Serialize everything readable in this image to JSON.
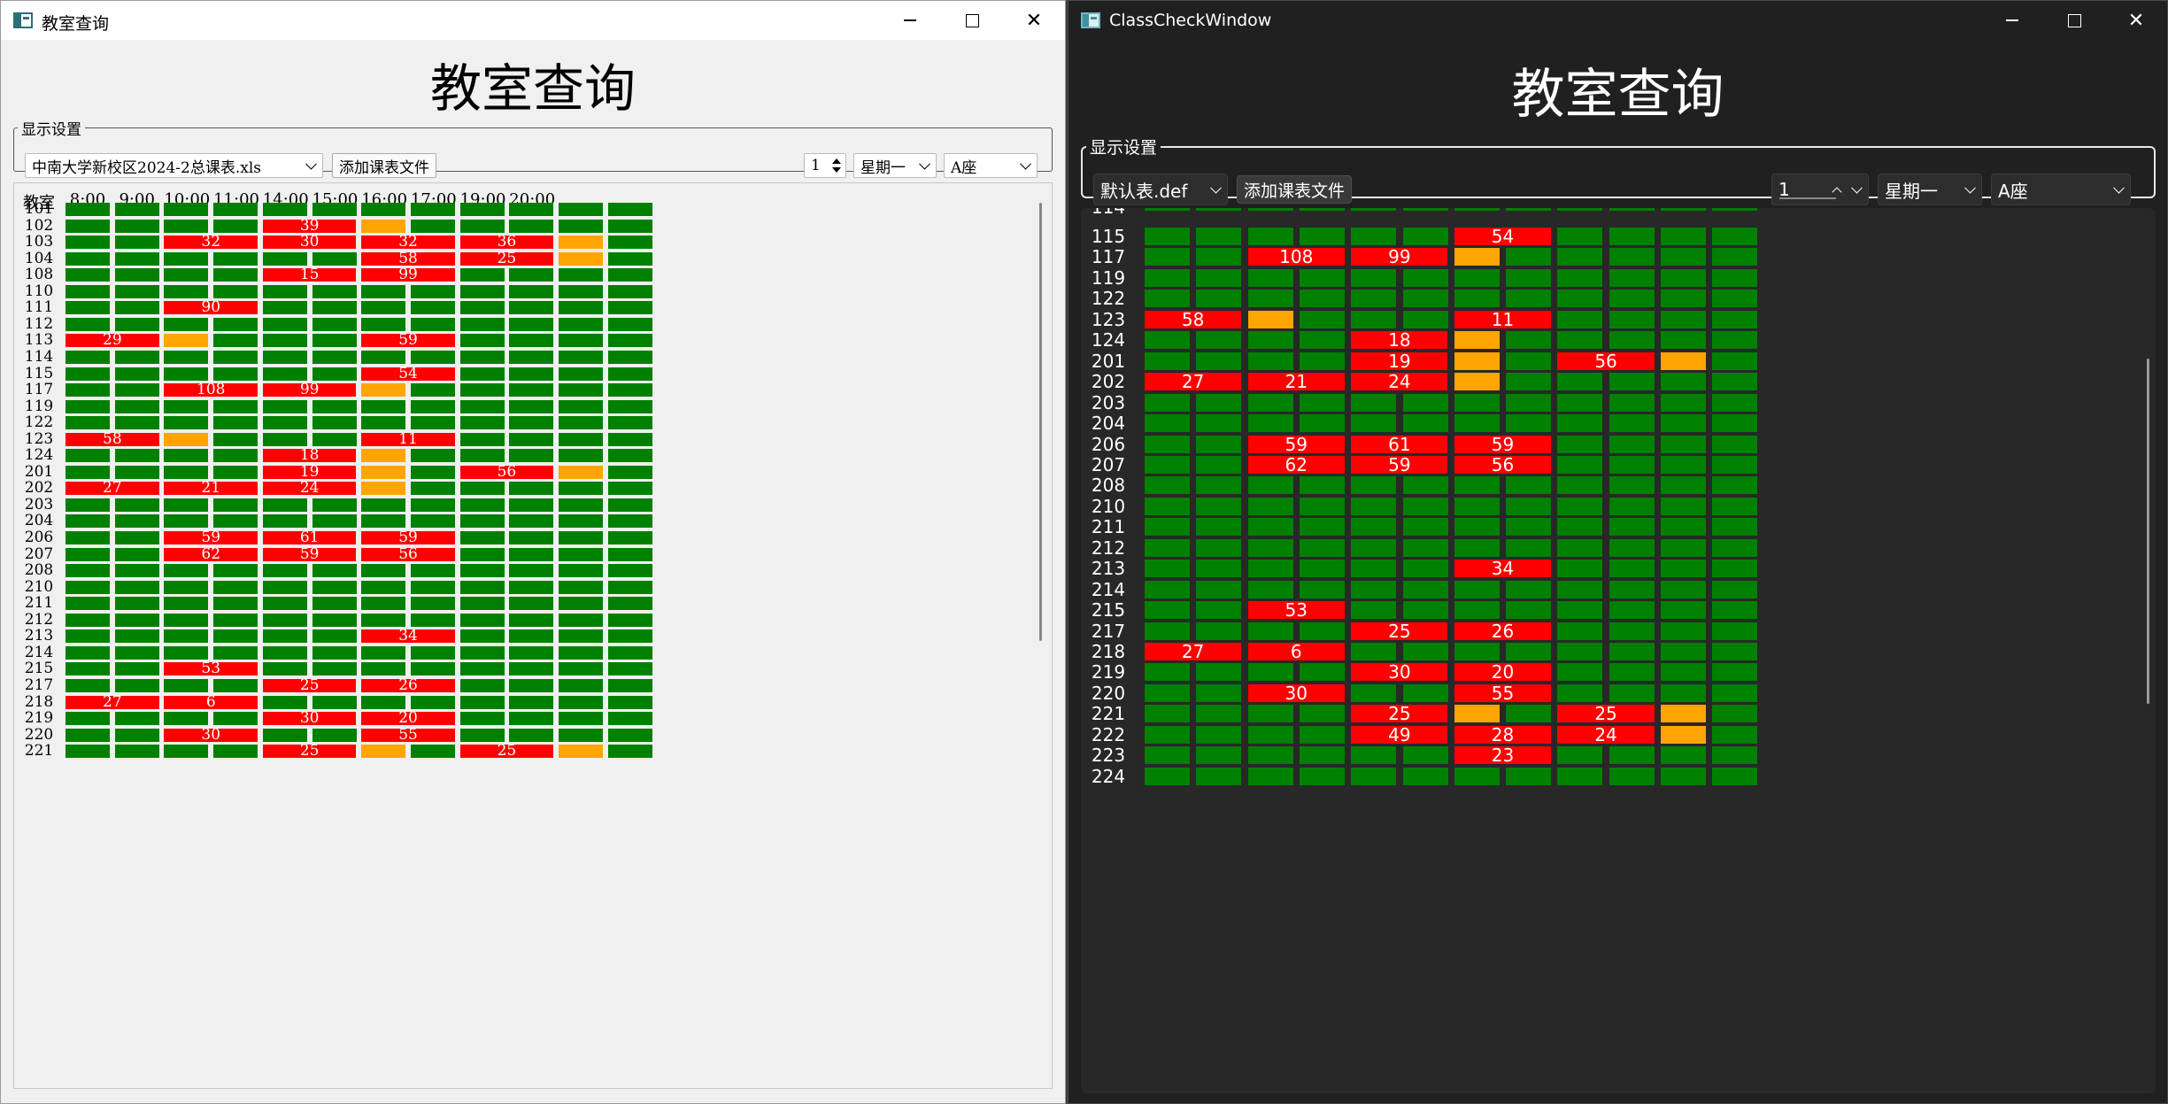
{
  "left": {
    "window_title": "教室查询",
    "heading": "教室查询",
    "group_title": "显示设置",
    "file_select": "中南大学新校区2024-2总课表.xls",
    "add_button": "添加课表文件",
    "week_spin": "1",
    "weekday_select": "星期一",
    "building_select": "A座",
    "header_room": "教室",
    "times": [
      "8:00",
      "9:00",
      "10:00",
      "11:00",
      "14:00",
      "15:00",
      "16:00",
      "17:00",
      "19:00",
      "20:00"
    ],
    "rows": [
      {
        "room": "101",
        "cells": [
          "g",
          "g",
          "g",
          "g",
          "g",
          "g",
          "g",
          "g",
          "g",
          "g",
          "g",
          "g"
        ]
      },
      {
        "room": "102",
        "cells": [
          "g",
          "g",
          "g",
          "g",
          "39",
          "",
          "o",
          "g",
          "g",
          "g",
          "g",
          "g"
        ]
      },
      {
        "room": "103",
        "cells": [
          "g",
          "g",
          "32",
          "",
          "30",
          "",
          "32",
          "",
          "36",
          "",
          "o",
          "g"
        ]
      },
      {
        "room": "104",
        "cells": [
          "g",
          "g",
          "g",
          "g",
          "g",
          "g",
          "58",
          "",
          "25",
          "",
          "o",
          "g"
        ]
      },
      {
        "room": "108",
        "cells": [
          "g",
          "g",
          "g",
          "g",
          "15",
          "",
          "99",
          "",
          "g",
          "g",
          "g",
          "g"
        ]
      },
      {
        "room": "110",
        "cells": [
          "g",
          "g",
          "g",
          "g",
          "g",
          "g",
          "g",
          "g",
          "g",
          "g",
          "g",
          "g"
        ]
      },
      {
        "room": "111",
        "cells": [
          "g",
          "g",
          "90",
          "",
          "g",
          "g",
          "g",
          "g",
          "g",
          "g",
          "g",
          "g"
        ]
      },
      {
        "room": "112",
        "cells": [
          "g",
          "g",
          "g",
          "g",
          "g",
          "g",
          "g",
          "g",
          "g",
          "g",
          "g",
          "g"
        ]
      },
      {
        "room": "113",
        "cells": [
          "29",
          "",
          "o",
          "g",
          "g",
          "g",
          "59",
          "",
          "g",
          "g",
          "g",
          "g"
        ]
      },
      {
        "room": "114",
        "cells": [
          "g",
          "g",
          "g",
          "g",
          "g",
          "g",
          "g",
          "g",
          "g",
          "g",
          "g",
          "g"
        ]
      },
      {
        "room": "115",
        "cells": [
          "g",
          "g",
          "g",
          "g",
          "g",
          "g",
          "54",
          "",
          "g",
          "g",
          "g",
          "g"
        ]
      },
      {
        "room": "117",
        "cells": [
          "g",
          "g",
          "108",
          "",
          "99",
          "",
          "o",
          "g",
          "g",
          "g",
          "g",
          "g"
        ]
      },
      {
        "room": "119",
        "cells": [
          "g",
          "g",
          "g",
          "g",
          "g",
          "g",
          "g",
          "g",
          "g",
          "g",
          "g",
          "g"
        ]
      },
      {
        "room": "122",
        "cells": [
          "g",
          "g",
          "g",
          "g",
          "g",
          "g",
          "g",
          "g",
          "g",
          "g",
          "g",
          "g"
        ]
      },
      {
        "room": "123",
        "cells": [
          "58",
          "",
          "o",
          "g",
          "g",
          "g",
          "11",
          "",
          "g",
          "g",
          "g",
          "g"
        ]
      },
      {
        "room": "124",
        "cells": [
          "g",
          "g",
          "g",
          "g",
          "18",
          "",
          "o",
          "g",
          "g",
          "g",
          "g",
          "g"
        ]
      },
      {
        "room": "201",
        "cells": [
          "g",
          "g",
          "g",
          "g",
          "19",
          "",
          "o",
          "g",
          "56",
          "",
          "o",
          "g"
        ]
      },
      {
        "room": "202",
        "cells": [
          "27",
          "",
          "21",
          "",
          "24",
          "",
          "o",
          "g",
          "g",
          "g",
          "g",
          "g"
        ]
      },
      {
        "room": "203",
        "cells": [
          "g",
          "g",
          "g",
          "g",
          "g",
          "g",
          "g",
          "g",
          "g",
          "g",
          "g",
          "g"
        ]
      },
      {
        "room": "204",
        "cells": [
          "g",
          "g",
          "g",
          "g",
          "g",
          "g",
          "g",
          "g",
          "g",
          "g",
          "g",
          "g"
        ]
      },
      {
        "room": "206",
        "cells": [
          "g",
          "g",
          "59",
          "",
          "61",
          "",
          "59",
          "",
          "g",
          "g",
          "g",
          "g"
        ]
      },
      {
        "room": "207",
        "cells": [
          "g",
          "g",
          "62",
          "",
          "59",
          "",
          "56",
          "",
          "g",
          "g",
          "g",
          "g"
        ]
      },
      {
        "room": "208",
        "cells": [
          "g",
          "g",
          "g",
          "g",
          "g",
          "g",
          "g",
          "g",
          "g",
          "g",
          "g",
          "g"
        ]
      },
      {
        "room": "210",
        "cells": [
          "g",
          "g",
          "g",
          "g",
          "g",
          "g",
          "g",
          "g",
          "g",
          "g",
          "g",
          "g"
        ]
      },
      {
        "room": "211",
        "cells": [
          "g",
          "g",
          "g",
          "g",
          "g",
          "g",
          "g",
          "g",
          "g",
          "g",
          "g",
          "g"
        ]
      },
      {
        "room": "212",
        "cells": [
          "g",
          "g",
          "g",
          "g",
          "g",
          "g",
          "g",
          "g",
          "g",
          "g",
          "g",
          "g"
        ]
      },
      {
        "room": "213",
        "cells": [
          "g",
          "g",
          "g",
          "g",
          "g",
          "g",
          "34",
          "",
          "g",
          "g",
          "g",
          "g"
        ]
      },
      {
        "room": "214",
        "cells": [
          "g",
          "g",
          "g",
          "g",
          "g",
          "g",
          "g",
          "g",
          "g",
          "g",
          "g",
          "g"
        ]
      },
      {
        "room": "215",
        "cells": [
          "g",
          "g",
          "53",
          "",
          "g",
          "g",
          "g",
          "g",
          "g",
          "g",
          "g",
          "g"
        ]
      },
      {
        "room": "217",
        "cells": [
          "g",
          "g",
          "g",
          "g",
          "25",
          "",
          "26",
          "",
          "g",
          "g",
          "g",
          "g"
        ]
      },
      {
        "room": "218",
        "cells": [
          "27",
          "",
          "6",
          "",
          "g",
          "g",
          "g",
          "g",
          "g",
          "g",
          "g",
          "g"
        ]
      },
      {
        "room": "219",
        "cells": [
          "g",
          "g",
          "g",
          "g",
          "30",
          "",
          "20",
          "",
          "g",
          "g",
          "g",
          "g"
        ]
      },
      {
        "room": "220",
        "cells": [
          "g",
          "g",
          "30",
          "",
          "g",
          "g",
          "55",
          "",
          "g",
          "g",
          "g",
          "g"
        ]
      },
      {
        "room": "221",
        "cells": [
          "g",
          "g",
          "g",
          "g",
          "25",
          "",
          "o",
          "g",
          "25",
          "",
          "o",
          "g"
        ]
      }
    ]
  },
  "right": {
    "window_title": "ClassCheckWindow",
    "heading": "教室查询",
    "group_title": "显示设置",
    "file_select": "默认表.def",
    "add_button": "添加课表文件",
    "week_spin": "1",
    "weekday_select": "星期一",
    "building_select": "A座",
    "partial_top_label": "114",
    "rows": [
      {
        "room": "115",
        "cells": [
          "g",
          "g",
          "g",
          "g",
          "g",
          "g",
          "54",
          "",
          "g",
          "g",
          "g",
          "g"
        ]
      },
      {
        "room": "117",
        "cells": [
          "g",
          "g",
          "108",
          "",
          "99",
          "",
          "o",
          "g",
          "g",
          "g",
          "g",
          "g"
        ]
      },
      {
        "room": "119",
        "cells": [
          "g",
          "g",
          "g",
          "g",
          "g",
          "g",
          "g",
          "g",
          "g",
          "g",
          "g",
          "g"
        ]
      },
      {
        "room": "122",
        "cells": [
          "g",
          "g",
          "g",
          "g",
          "g",
          "g",
          "g",
          "g",
          "g",
          "g",
          "g",
          "g"
        ]
      },
      {
        "room": "123",
        "cells": [
          "58",
          "",
          "o",
          "g",
          "g",
          "g",
          "11",
          "",
          "g",
          "g",
          "g",
          "g"
        ]
      },
      {
        "room": "124",
        "cells": [
          "g",
          "g",
          "g",
          "g",
          "18",
          "",
          "o",
          "g",
          "g",
          "g",
          "g",
          "g"
        ]
      },
      {
        "room": "201",
        "cells": [
          "g",
          "g",
          "g",
          "g",
          "19",
          "",
          "o",
          "g",
          "56",
          "",
          "o",
          "g"
        ]
      },
      {
        "room": "202",
        "cells": [
          "27",
          "",
          "21",
          "",
          "24",
          "",
          "o",
          "g",
          "g",
          "g",
          "g",
          "g"
        ]
      },
      {
        "room": "203",
        "cells": [
          "g",
          "g",
          "g",
          "g",
          "g",
          "g",
          "g",
          "g",
          "g",
          "g",
          "g",
          "g"
        ]
      },
      {
        "room": "204",
        "cells": [
          "g",
          "g",
          "g",
          "g",
          "g",
          "g",
          "g",
          "g",
          "g",
          "g",
          "g",
          "g"
        ]
      },
      {
        "room": "206",
        "cells": [
          "g",
          "g",
          "59",
          "",
          "61",
          "",
          "59",
          "",
          "g",
          "g",
          "g",
          "g"
        ]
      },
      {
        "room": "207",
        "cells": [
          "g",
          "g",
          "62",
          "",
          "59",
          "",
          "56",
          "",
          "g",
          "g",
          "g",
          "g"
        ]
      },
      {
        "room": "208",
        "cells": [
          "g",
          "g",
          "g",
          "g",
          "g",
          "g",
          "g",
          "g",
          "g",
          "g",
          "g",
          "g"
        ]
      },
      {
        "room": "210",
        "cells": [
          "g",
          "g",
          "g",
          "g",
          "g",
          "g",
          "g",
          "g",
          "g",
          "g",
          "g",
          "g"
        ]
      },
      {
        "room": "211",
        "cells": [
          "g",
          "g",
          "g",
          "g",
          "g",
          "g",
          "g",
          "g",
          "g",
          "g",
          "g",
          "g"
        ]
      },
      {
        "room": "212",
        "cells": [
          "g",
          "g",
          "g",
          "g",
          "g",
          "g",
          "g",
          "g",
          "g",
          "g",
          "g",
          "g"
        ]
      },
      {
        "room": "213",
        "cells": [
          "g",
          "g",
          "g",
          "g",
          "g",
          "g",
          "34",
          "",
          "g",
          "g",
          "g",
          "g"
        ]
      },
      {
        "room": "214",
        "cells": [
          "g",
          "g",
          "g",
          "g",
          "g",
          "g",
          "g",
          "g",
          "g",
          "g",
          "g",
          "g"
        ]
      },
      {
        "room": "215",
        "cells": [
          "g",
          "g",
          "53",
          "",
          "g",
          "g",
          "g",
          "g",
          "g",
          "g",
          "g",
          "g"
        ]
      },
      {
        "room": "217",
        "cells": [
          "g",
          "g",
          "g",
          "g",
          "25",
          "",
          "26",
          "",
          "g",
          "g",
          "g",
          "g"
        ]
      },
      {
        "room": "218",
        "cells": [
          "27",
          "",
          "6",
          "",
          "g",
          "g",
          "g",
          "g",
          "g",
          "g",
          "g",
          "g"
        ]
      },
      {
        "room": "219",
        "cells": [
          "g",
          "g",
          "g",
          "g",
          "30",
          "",
          "20",
          "",
          "g",
          "g",
          "g",
          "g"
        ]
      },
      {
        "room": "220",
        "cells": [
          "g",
          "g",
          "30",
          "",
          "g",
          "g",
          "55",
          "",
          "g",
          "g",
          "g",
          "g"
        ]
      },
      {
        "room": "221",
        "cells": [
          "g",
          "g",
          "g",
          "g",
          "25",
          "",
          "o",
          "g",
          "25",
          "",
          "o",
          "g"
        ]
      },
      {
        "room": "222",
        "cells": [
          "g",
          "g",
          "g",
          "g",
          "49",
          "",
          "28",
          "",
          "24",
          "",
          "o",
          "g"
        ]
      },
      {
        "room": "223",
        "cells": [
          "g",
          "g",
          "g",
          "g",
          "g",
          "g",
          "23",
          "",
          "g",
          "g",
          "g",
          "g"
        ]
      },
      {
        "room": "224",
        "cells": [
          "g",
          "g",
          "g",
          "g",
          "g",
          "g",
          "g",
          "g",
          "g",
          "g",
          "g",
          "g"
        ]
      }
    ]
  },
  "colors": {
    "free": "#008000",
    "occupied": "#ff0000",
    "partial": "#ffa500"
  },
  "icons": {
    "app": "app-window-icon",
    "minimize": "minimize-icon",
    "maximize": "maximize-icon",
    "close": "close-icon"
  }
}
